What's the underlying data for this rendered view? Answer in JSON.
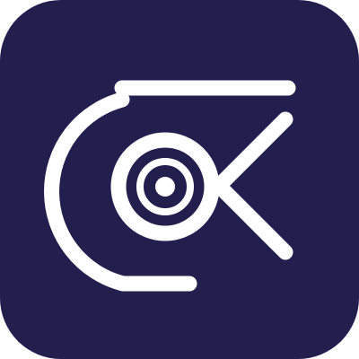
{
  "app_icon": {
    "icon_name": "eye-k-logo-icon",
    "background_color": "#221F4E",
    "foreground_color": "#FFFFFF"
  }
}
